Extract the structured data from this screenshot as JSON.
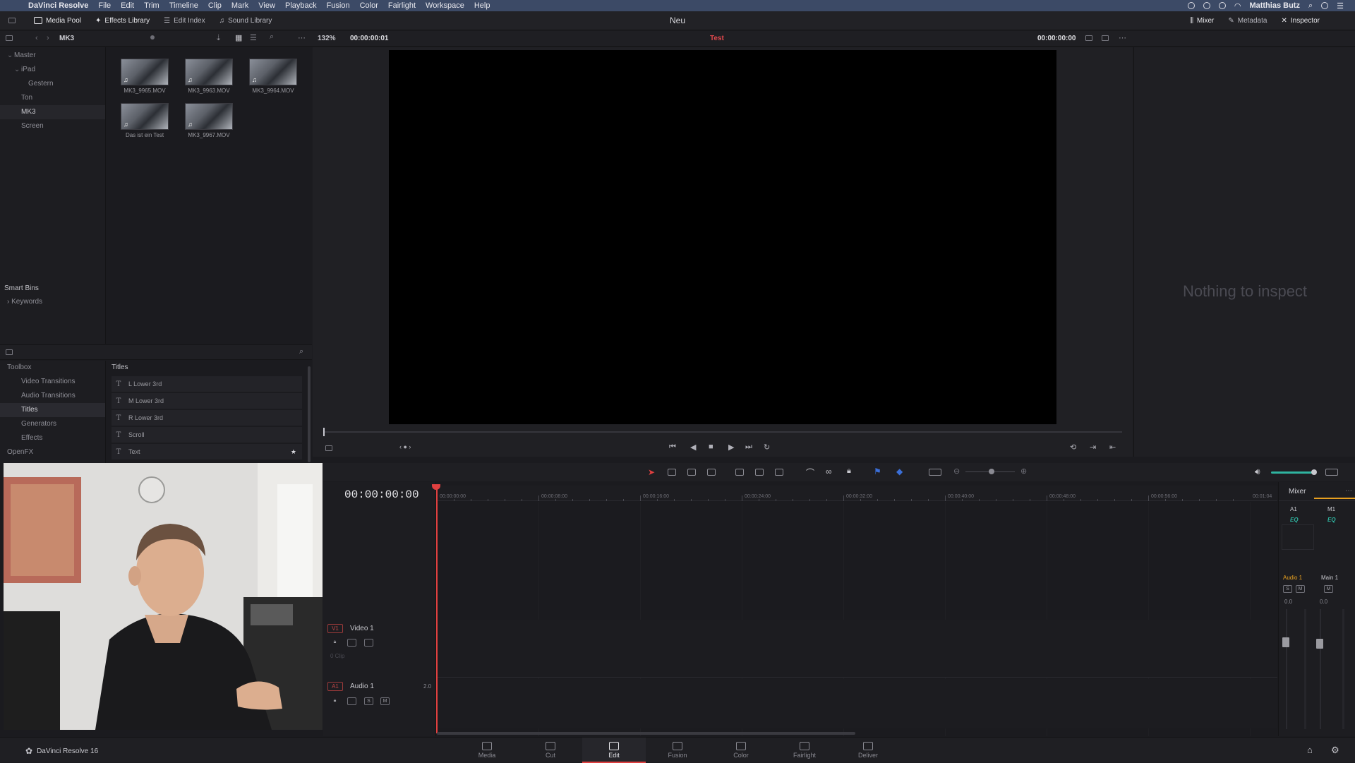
{
  "menubar": {
    "app": "DaVinci Resolve",
    "items": [
      "File",
      "Edit",
      "Trim",
      "Timeline",
      "Clip",
      "Mark",
      "View",
      "Playback",
      "Fusion",
      "Color",
      "Fairlight",
      "Workspace",
      "Help"
    ],
    "user": "Matthias Butz"
  },
  "toolbar": {
    "media_pool": "Media Pool",
    "effects_library": "Effects Library",
    "edit_index": "Edit Index",
    "sound_library": "Sound Library",
    "project_title": "Neu",
    "mixer": "Mixer",
    "metadata": "Metadata",
    "inspector": "Inspector"
  },
  "subbar": {
    "bin_name": "MK3",
    "zoom": "132%",
    "source_timecode": "00:00:00:01",
    "timeline_name": "Test",
    "timeline_timecode": "00:00:00:00"
  },
  "bins": {
    "items": [
      {
        "label": "Master",
        "indent": 0,
        "arrow": "⌄"
      },
      {
        "label": "iPad",
        "indent": 1,
        "arrow": "⌄"
      },
      {
        "label": "Gestern",
        "indent": 2,
        "arrow": ""
      },
      {
        "label": "Ton",
        "indent": 1,
        "arrow": ""
      },
      {
        "label": "MK3",
        "indent": 1,
        "arrow": ""
      },
      {
        "label": "Screen",
        "indent": 1,
        "arrow": ""
      }
    ],
    "selected": "MK3",
    "smart_bins": "Smart Bins",
    "keywords": "Keywords"
  },
  "clips": [
    "MK3_9965.MOV",
    "MK3_9963.MOV",
    "MK3_9964.MOV",
    "Das ist ein Test",
    "MK3_9967.MOV"
  ],
  "toolbox": {
    "items": [
      {
        "label": "Toolbox",
        "indent": 0
      },
      {
        "label": "Video Transitions",
        "indent": 1
      },
      {
        "label": "Audio Transitions",
        "indent": 1
      },
      {
        "label": "Titles",
        "indent": 1
      },
      {
        "label": "Generators",
        "indent": 1
      },
      {
        "label": "Effects",
        "indent": 1
      },
      {
        "label": "OpenFX",
        "indent": 0
      }
    ],
    "selected": "Titles"
  },
  "titles": {
    "header": "Titles",
    "items": [
      "L Lower 3rd",
      "M Lower 3rd",
      "R Lower 3rd",
      "Scroll",
      "Text"
    ]
  },
  "inspector": {
    "empty_message": "Nothing to inspect"
  },
  "timeline": {
    "timecode": "00:00:00:00",
    "ruler": [
      "00:00:00:00",
      "00:00:08:00",
      "00:00:16:00",
      "00:00:24:00",
      "00:00:32:00",
      "00:00:40:00",
      "00:00:48:00",
      "00:00:56:00",
      "00:01:04"
    ],
    "video_track": {
      "tag": "V1",
      "name": "Video 1",
      "clips_label": "0 Clip"
    },
    "audio_track": {
      "tag": "A1",
      "name": "Audio 1",
      "channels": "2.0",
      "solo": "S",
      "mute": "M"
    }
  },
  "mixer": {
    "title": "Mixer",
    "ch1": "A1",
    "ch2": "M1",
    "eq": "EQ",
    "ch1_name": "Audio 1",
    "ch2_name": "Main 1",
    "solo": "S",
    "mute": "M",
    "level": "0.0"
  },
  "pages": {
    "brand": "DaVinci Resolve 16",
    "items": [
      "Media",
      "Cut",
      "Edit",
      "Fusion",
      "Color",
      "Fairlight",
      "Deliver"
    ],
    "active": "Edit"
  },
  "colors": {
    "accent_red": "#e04040",
    "timeline_name": "#e0484c",
    "mixer_active": "#e8a020"
  }
}
